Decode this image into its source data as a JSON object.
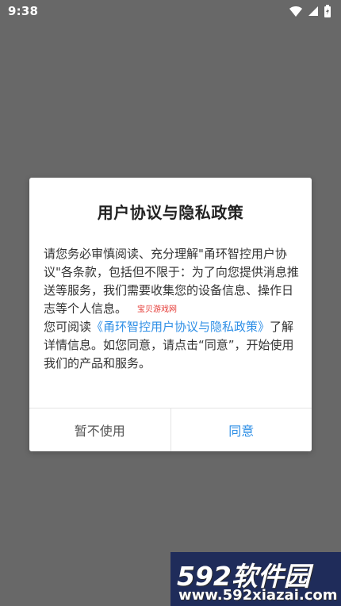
{
  "status_bar": {
    "time": "9:38",
    "icons": [
      "wifi-icon",
      "signal-icon",
      "battery-icon"
    ]
  },
  "dialog": {
    "title": "用户协议与隐私政策",
    "paragraph1": "请您务必审慎阅读、充分理解\"甬环智控用户协议\"各条款，包括但不限于：为了向您提供消息推送等服务，我们需要收集您的设备信息、操作日志等个人信息。",
    "paragraph2_prefix": "您可阅读",
    "policy_link": "《甬环智控用户协议与隐私政策》",
    "paragraph2_suffix": "了解详情信息。如您同意，请点击“同意”，开始使用我们的产品和服务。",
    "small_watermark": "宝贝游戏网",
    "decline_label": "暂不使用",
    "agree_label": "同意"
  },
  "watermark": {
    "logo": "592软件园",
    "url": "www.592xiazai.com"
  },
  "colors": {
    "backdrop": "#686868",
    "link": "#2f8fe6",
    "watermark_bg": "#1f2c5a"
  }
}
